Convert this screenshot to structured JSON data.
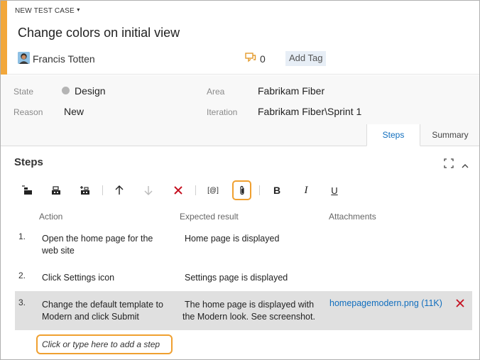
{
  "header": {
    "work_item_type": "NEW TEST CASE",
    "title": "Change colors on initial view",
    "assignee": "Francis Totten",
    "comment_count": "0",
    "add_tag_label": "Add Tag",
    "accent_color": "#f2a73b"
  },
  "fields": {
    "state_label": "State",
    "state_value": "Design",
    "reason_label": "Reason",
    "reason_value": "New",
    "area_label": "Area",
    "area_value": "Fabrikam Fiber",
    "iteration_label": "Iteration",
    "iteration_value": "Fabrikam Fiber\\Sprint 1"
  },
  "tabs": [
    {
      "label": "Steps",
      "selected": true
    },
    {
      "label": "Summary",
      "selected": false
    }
  ],
  "steps": {
    "title": "Steps",
    "toolbar": [
      "insert-step-icon",
      "insert-shared-steps-icon",
      "create-shared-steps-icon",
      "move-up-icon",
      "move-down-icon",
      "delete-step-icon",
      "insert-parameter-icon",
      "attachment-icon",
      "bold-icon",
      "italic-icon",
      "underline-icon"
    ],
    "parameter_label": "[@]",
    "bold_label": "B",
    "italic_label": "I",
    "underline_label": "U",
    "columns": [
      "Action",
      "Expected result",
      "Attachments"
    ],
    "rows": [
      {
        "num": "1.",
        "action_line1": "Open the home page for the",
        "action_line2": "web site",
        "expected_line1": "Home page is displayed",
        "expected_line2": "",
        "attachment": ""
      },
      {
        "num": "2.",
        "action_line1": "Click Settings icon",
        "action_line2": "",
        "expected_line1": "Settings page is displayed",
        "expected_line2": "",
        "attachment": ""
      },
      {
        "num": "3.",
        "action_line1": "Change the default template to",
        "action_line2": "Modern and click Submit",
        "expected_line1": "The home page is displayed with",
        "expected_line2": "the Modern look. See screenshot.",
        "attachment": "homepagemodern.png (11K)"
      }
    ],
    "add_step_placeholder": "Click or type here to add a step"
  },
  "colors": {
    "highlight": "#f0a030",
    "link": "#106ebe",
    "delete": "#c50f1f"
  }
}
